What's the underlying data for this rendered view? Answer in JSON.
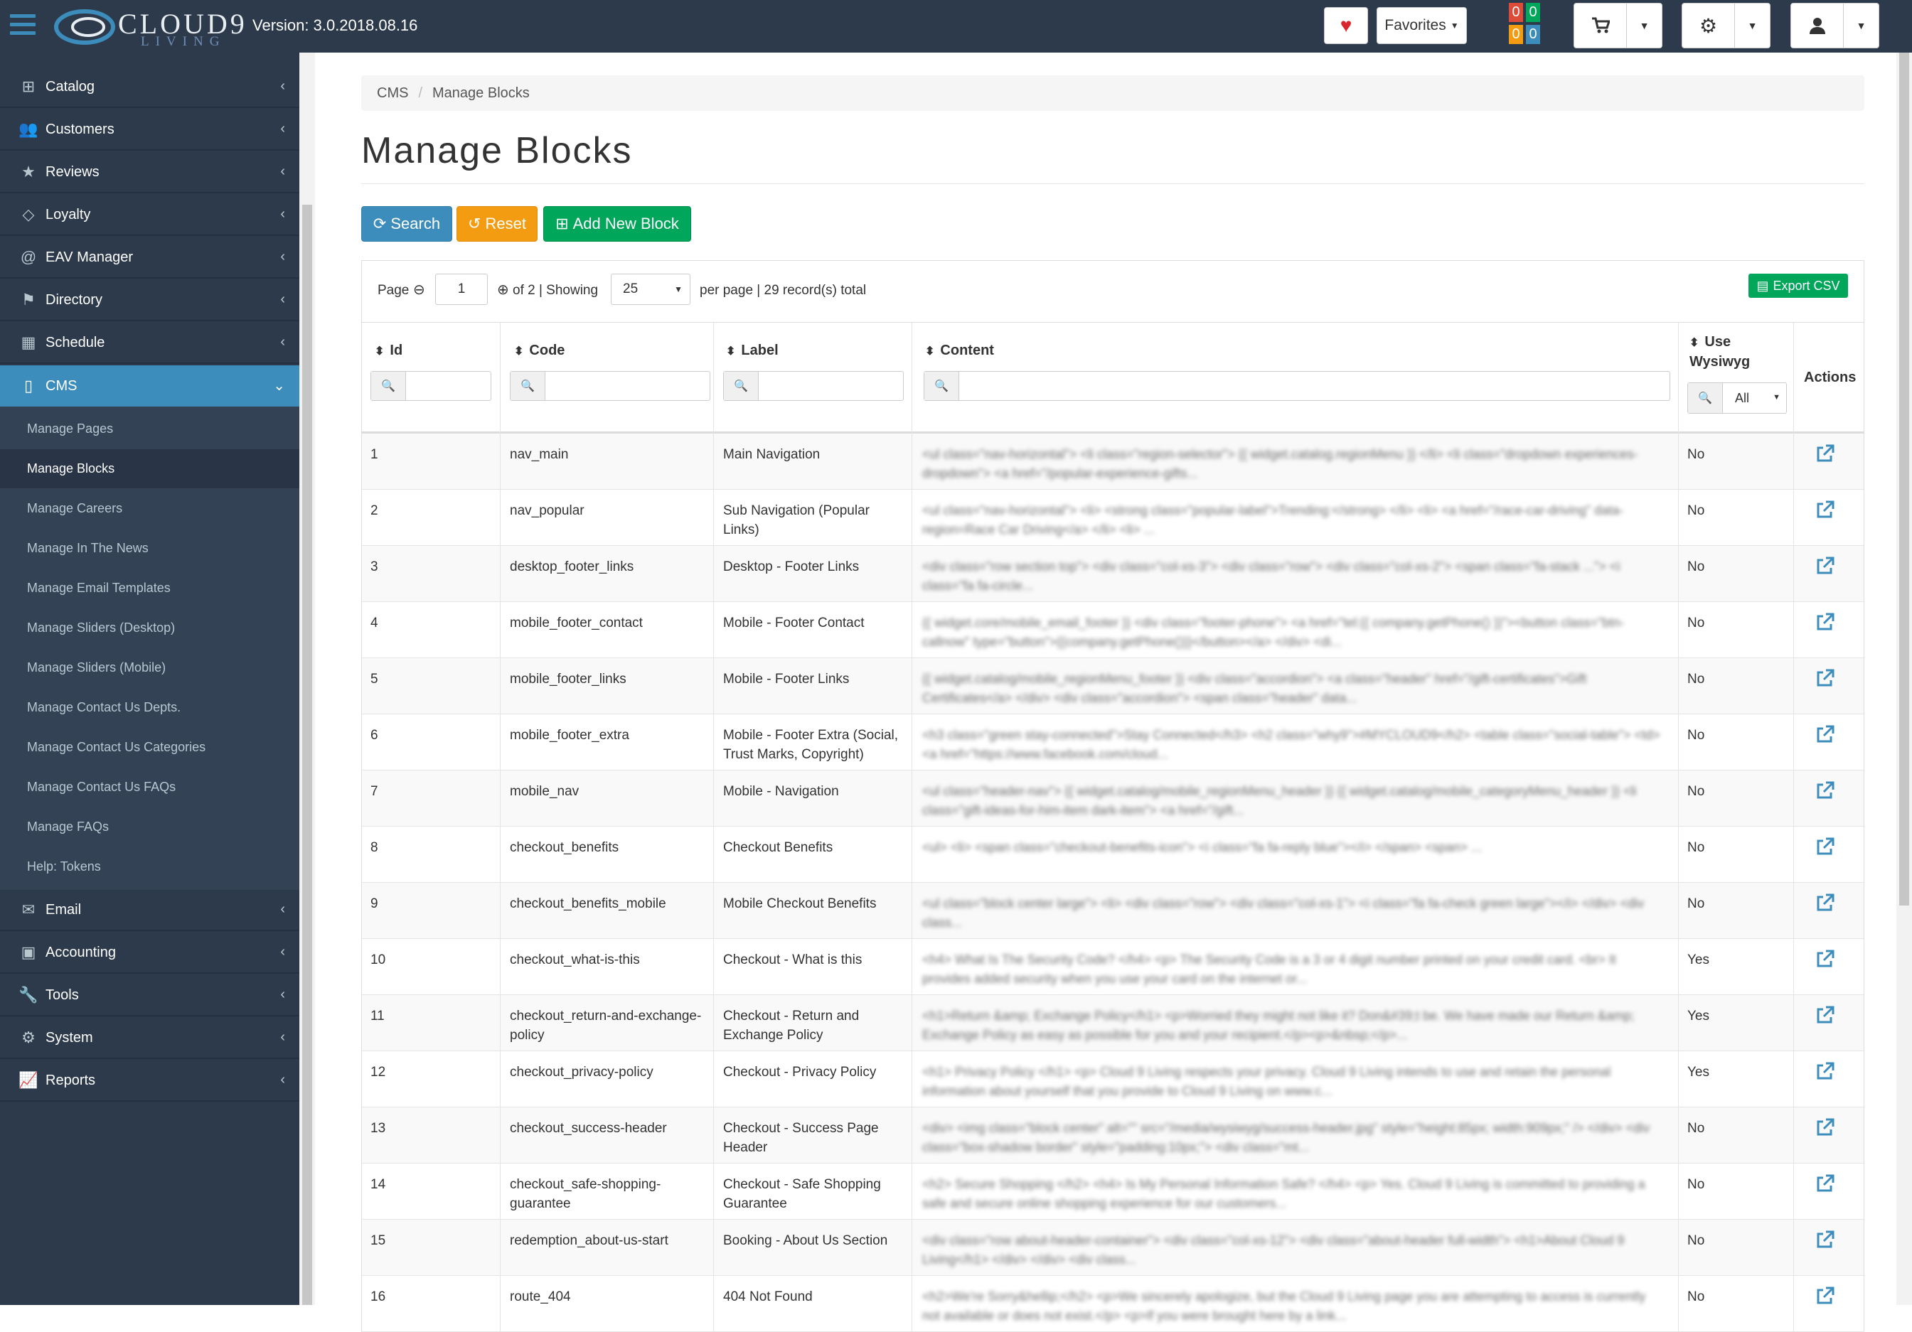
{
  "topbar": {
    "logo_text": "CLOUD9",
    "logo_sub": "LIVING",
    "version": "Version: 3.0.2018.08.16",
    "favorites_label": "Favorites",
    "counters": [
      "0",
      "0",
      "0",
      "0"
    ],
    "colors": {
      "background": "#2d3a4b",
      "red": "#dd4b39",
      "green": "#00a65a",
      "orange": "#f39c12",
      "blue": "#3c8dbc"
    }
  },
  "sidebar": {
    "items": [
      {
        "label": "Catalog",
        "icon": "sitemap-icon"
      },
      {
        "label": "Customers",
        "icon": "users-icon"
      },
      {
        "label": "Reviews",
        "icon": "star-icon"
      },
      {
        "label": "Loyalty",
        "icon": "diamond-icon"
      },
      {
        "label": "EAV Manager",
        "icon": "at-icon"
      },
      {
        "label": "Directory",
        "icon": "flag-icon"
      },
      {
        "label": "Schedule",
        "icon": "calendar-icon"
      },
      {
        "label": "CMS",
        "icon": "file-icon"
      },
      {
        "label": "Email",
        "icon": "envelope-icon"
      },
      {
        "label": "Accounting",
        "icon": "money-icon"
      },
      {
        "label": "Tools",
        "icon": "wrench-icon"
      },
      {
        "label": "System",
        "icon": "cogs-icon"
      },
      {
        "label": "Reports",
        "icon": "line-chart-icon"
      }
    ],
    "cms_sub": [
      "Manage Pages",
      "Manage Blocks",
      "Manage Careers",
      "Manage In The News",
      "Manage Email Templates",
      "Manage Sliders (Desktop)",
      "Manage Sliders (Mobile)",
      "Manage Contact Us Depts.",
      "Manage Contact Us Categories",
      "Manage Contact Us FAQs",
      "Manage FAQs",
      "Help: Tokens"
    ]
  },
  "breadcrumb": [
    "CMS",
    "Manage Blocks"
  ],
  "page_title": "Manage Blocks",
  "buttons": {
    "search": "Search",
    "reset": "Reset",
    "add": "Add New Block"
  },
  "pager": {
    "page_label": "Page",
    "page_value": "1",
    "of_text": "of 2 | Showing",
    "per_page_value": "25",
    "per_page_text": "per page | 29 record(s) total",
    "export_label": "Export CSV"
  },
  "table": {
    "headers": {
      "id": "Id",
      "code": "Code",
      "label": "Label",
      "content": "Content",
      "wysiwyg_1": "Use",
      "wysiwyg_2": "Wysiwyg",
      "actions": "Actions"
    },
    "wysiwyg_filter": "All",
    "rows": [
      {
        "id": "1",
        "code": "nav_main",
        "label": "Main Navigation",
        "content": "<ul class=\"nav-horizontal\"> <li class=\"region-selector\"> {{ widget.catalog.regionMenu }} </li> <li class=\"dropdown experiences-dropdown\"> <a href=\"/popular-experience-gifts...",
        "wysiwyg": "No"
      },
      {
        "id": "2",
        "code": "nav_popular",
        "label": "Sub Navigation (Popular Links)",
        "content": "<ul class=\"nav-horizontal\"> <li> <strong class=\"popular-label\">Trending:</strong> </li> <li> <a href=\"/race-car-driving\" data-region=Race Car Driving</a> </li> <li> ...",
        "wysiwyg": "No"
      },
      {
        "id": "3",
        "code": "desktop_footer_links",
        "label": "Desktop - Footer Links",
        "content": "<div class=\"row section top\"> <div class=\"col-xs-3\"> <div class=\"row\"> <div class=\"col-xs-2\"> <span class=\"fa-stack ...\"> <i class=\"fa fa-circle...",
        "wysiwyg": "No"
      },
      {
        "id": "4",
        "code": "mobile_footer_contact",
        "label": "Mobile - Footer Contact",
        "content": "{{ widget.core/mobile_email_footer }} <div class=\"footer-phone\"> <a href=\"tel:{{ company.getPhone() }}\"><button class=\"btn-callnow\" type=\"button\">{{company.getPhone()}}</button></a> </div> <di...",
        "wysiwyg": "No"
      },
      {
        "id": "5",
        "code": "mobile_footer_links",
        "label": "Mobile - Footer Links",
        "content": "{{ widget.catalog/mobile_regionMenu_footer }} <div class=\"accordion\"> <a class=\"header\" href=\"/gift-certificates\">Gift Certificates</a> </div> <div class=\"accordion\"> <span class=\"header\" data...",
        "wysiwyg": "No"
      },
      {
        "id": "6",
        "code": "mobile_footer_extra",
        "label": "Mobile - Footer Extra (Social, Trust Marks, Copyright)",
        "content": "<h3 class=\"green stay-connected\">Stay Connected</h3> <h2 class=\"why9\">#MYCLOUD9</h2> <table class=\"social-table\"> <td><a href=\"https://www.facebook.com/cloud...",
        "wysiwyg": "No"
      },
      {
        "id": "7",
        "code": "mobile_nav",
        "label": "Mobile - Navigation",
        "content": "<ul class=\"header-nav\"> {{ widget.catalog/mobile_regionMenu_header }} {{ widget.catalog/mobile_categoryMenu_header }} <li class=\"gift-ideas-for-him-item dark-item\"> <a href=\"/gift...",
        "wysiwyg": "No"
      },
      {
        "id": "8",
        "code": "checkout_benefits",
        "label": "Checkout Benefits",
        "content": "<ul> <li> <span class=\"checkout-benefits-icon\"> <i class=\"fa fa-reply blue\"></i> </span> <span> ...",
        "wysiwyg": "No"
      },
      {
        "id": "9",
        "code": "checkout_benefits_mobile",
        "label": "Mobile Checkout Benefits",
        "content": "<ul class=\"block center large\"> <li> <div class=\"row\"> <div class=\"col-xs-1\"> <i class=\"fa fa-check green large\"></i> </div> <div class...",
        "wysiwyg": "No"
      },
      {
        "id": "10",
        "code": "checkout_what-is-this",
        "label": "Checkout - What is this",
        "content": "<h4> What Is The Security Code? </h4> <p> The Security Code is a 3 or 4 digit number printed on your credit card. <br> It provides added security when you use your card on the internet or...",
        "wysiwyg": "Yes"
      },
      {
        "id": "11",
        "code": "checkout_return-and-exchange-policy",
        "label": "Checkout - Return and Exchange Policy",
        "content": "<h1>Return &amp; Exchange Policy</h1> <p>Worried they might not like it? Don&#39;t be. We have made our Return &amp; Exchange Policy as easy as possible for you and your recipient.</p><p>&nbsp;</p>...",
        "wysiwyg": "Yes"
      },
      {
        "id": "12",
        "code": "checkout_privacy-policy",
        "label": "Checkout - Privacy Policy",
        "content": "<h1> Privacy Policy </h1> <p> Cloud 9 Living respects your privacy. Cloud 9 Living intends to use and retain the personal information about yourself that you provide to Cloud 9 Living on www.c...",
        "wysiwyg": "Yes"
      },
      {
        "id": "13",
        "code": "checkout_success-header",
        "label": "Checkout - Success Page Header",
        "content": "<div> <img class=\"block center\" alt=\"\" src=\"/media/wysiwyg/success-header.jpg\" style=\"height:85px; width:909px;\" /> </div> <div class=\"box-shadow border\" style=\"padding:10px;\"> <div class=\"mt...",
        "wysiwyg": "No"
      },
      {
        "id": "14",
        "code": "checkout_safe-shopping-guarantee",
        "label": "Checkout - Safe Shopping Guarantee",
        "content": "<h2> Secure Shopping </h2> <h4> Is My Personal Information Safe? </h4> <p> Yes. Cloud 9 Living is committed to providing a safe and secure online shopping experience for our customers...",
        "wysiwyg": "No"
      },
      {
        "id": "15",
        "code": "redemption_about-us-start",
        "label": "Booking - About Us Section",
        "content": "<div class=\"row about-header-container\"> <div class=\"col-xs-12\"> <div class=\"about-header full-width\"> <h1>About Cloud 9 Living</h1> </div> </div> <div class...",
        "wysiwyg": "No"
      },
      {
        "id": "16",
        "code": "route_404",
        "label": "404 Not Found",
        "content": "<h2>We're Sorry&hellip;</h2> <p>We sincerely apologize, but the Cloud 9 Living page you are attempting to access is currently not available or does not exist.</p> <p>If you were brought here by a link...",
        "wysiwyg": "No"
      }
    ]
  }
}
